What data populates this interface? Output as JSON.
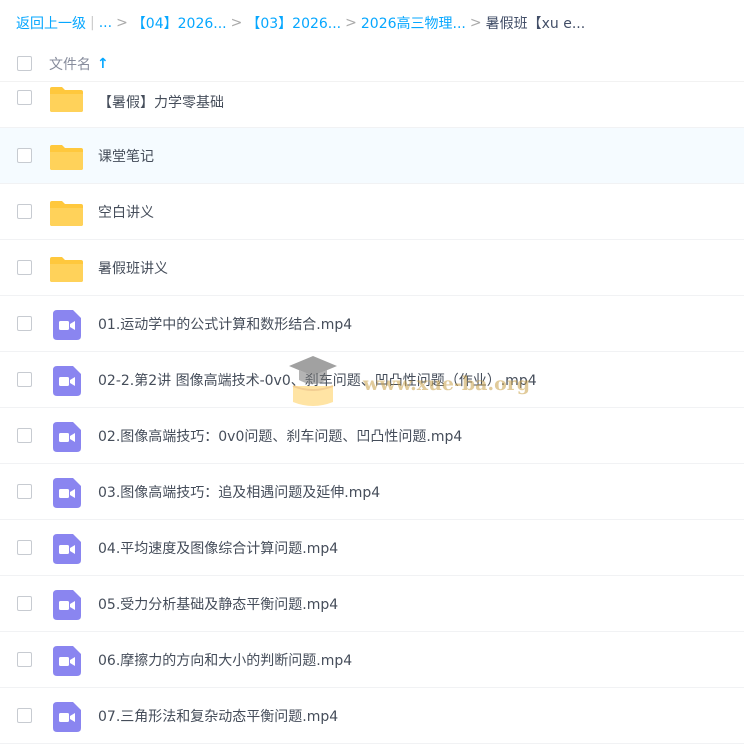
{
  "breadcrumb": {
    "back": "返回上一级",
    "ellipsis": "...",
    "items": [
      "【04】2026...",
      "【03】2026...",
      "2026高三物理...",
      "暑假班【xu e..."
    ]
  },
  "header": {
    "col_name": "文件名"
  },
  "files": [
    {
      "name": "【暑假】力学零基础",
      "type": "folder"
    },
    {
      "name": "课堂笔记",
      "type": "folder"
    },
    {
      "name": "空白讲义",
      "type": "folder"
    },
    {
      "name": "暑假班讲义",
      "type": "folder"
    },
    {
      "name": "01.运动学中的公式计算和数形结合.mp4",
      "type": "video"
    },
    {
      "name": "02-2.第2讲 图像高端技术-0v0、刹车问题、凹凸性问题（作业）.mp4",
      "type": "video"
    },
    {
      "name": "02.图像高端技巧：0v0问题、刹车问题、凹凸性问题.mp4",
      "type": "video"
    },
    {
      "name": "03.图像高端技巧：追及相遇问题及延伸.mp4",
      "type": "video"
    },
    {
      "name": "04.平均速度及图像综合计算问题.mp4",
      "type": "video"
    },
    {
      "name": "05.受力分析基础及静态平衡问题.mp4",
      "type": "video"
    },
    {
      "name": "06.摩擦力的方向和大小的判断问题.mp4",
      "type": "video"
    },
    {
      "name": "07.三角形法和复杂动态平衡问题.mp4",
      "type": "video"
    }
  ],
  "watermark": "www.xue-ba.org",
  "colors": {
    "link": "#06a7ff",
    "folder": "#ffc83d",
    "video": "#8a85f0"
  }
}
